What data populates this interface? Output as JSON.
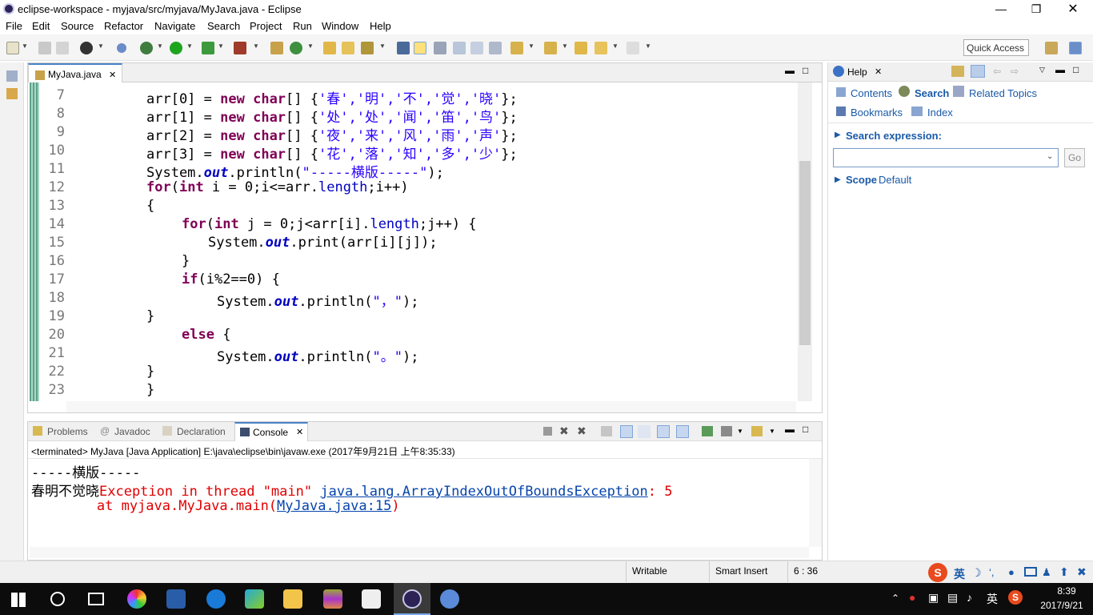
{
  "window": {
    "title": "eclipse-workspace - myjava/src/myjava/MyJava.java - Eclipse"
  },
  "menu": [
    "File",
    "Edit",
    "Source",
    "Refactor",
    "Navigate",
    "Search",
    "Project",
    "Run",
    "Window",
    "Help"
  ],
  "toolbar": {
    "quick_access": "Quick Access"
  },
  "editor": {
    "tab": "MyJava.java",
    "line_numbers": [
      "7",
      "8",
      "9",
      "10",
      "11",
      "12",
      "13",
      "14",
      "15",
      "16",
      "17",
      "18",
      "19",
      "20",
      "21",
      "22",
      "23"
    ]
  },
  "help": {
    "title": "Help",
    "links": {
      "contents": "Contents",
      "search": "Search",
      "related": "Related Topics",
      "bookmarks": "Bookmarks",
      "index": "Index"
    },
    "search_expression": "Search expression:",
    "go": "Go",
    "scope_label": "Scope",
    "scope_value": "Default"
  },
  "bottom": {
    "tabs": {
      "problems": "Problems",
      "javadoc": "Javadoc",
      "declaration": "Declaration",
      "console": "Console"
    },
    "terminated": "<terminated> MyJava [Java Application] E:\\java\\eclipse\\bin\\javaw.exe (2017年9月21日 上午8:35:33)",
    "out1": "-----横版-----",
    "out2_prefix": "春明不觉晓",
    "out2_exc": "Exception in thread \"main\" ",
    "out2_link": "java.lang.ArrayIndexOutOfBoundsException",
    "out2_tail": ": 5",
    "out3_prefix": "        at myjava.MyJava.main(",
    "out3_link": "MyJava.java:15",
    "out3_tail": ")"
  },
  "status": {
    "writable": "Writable",
    "insert": "Smart Insert",
    "pos": "6 : 36"
  },
  "taskbar": {
    "ime_lang": "英",
    "tray_lang": "英",
    "time": "8:39",
    "date": "2017/9/21"
  }
}
